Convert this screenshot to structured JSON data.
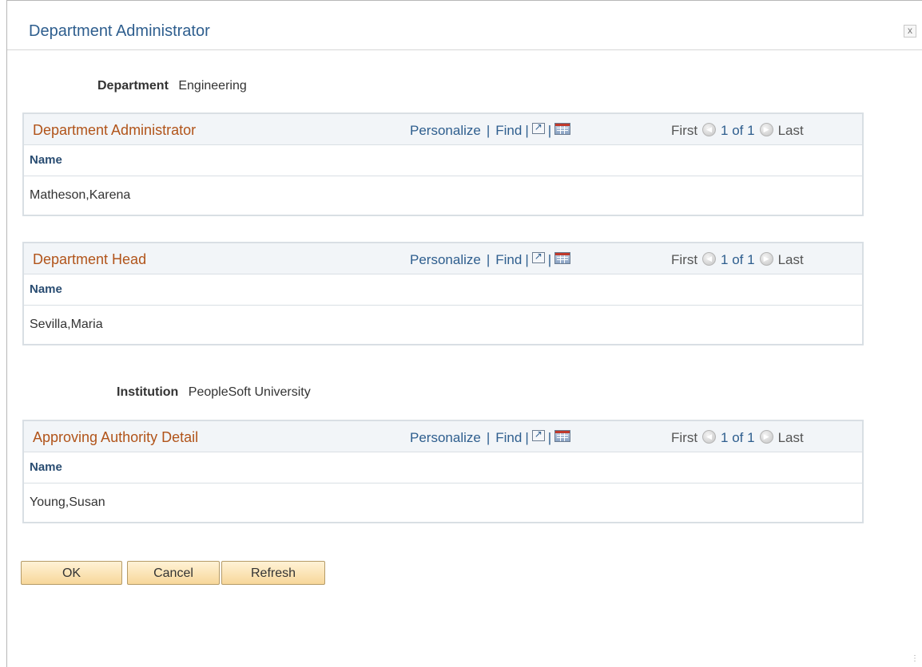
{
  "dialog": {
    "title": "Department Administrator",
    "close_label": "x"
  },
  "department": {
    "label": "Department",
    "value": "Engineering"
  },
  "institution": {
    "label": "Institution",
    "value": "PeopleSoft University"
  },
  "grid_nav": {
    "personalize": "Personalize",
    "separator": "|",
    "find": "Find",
    "first": "First",
    "last": "Last"
  },
  "grids": [
    {
      "title": "Department Administrator",
      "column": "Name",
      "row": "Matheson,Karena",
      "count": "1 of 1"
    },
    {
      "title": "Department Head",
      "column": "Name",
      "row": "Sevilla,Maria",
      "count": "1 of 1"
    },
    {
      "title": "Approving Authority Detail",
      "column": "Name",
      "row": "Young,Susan",
      "count": "1 of 1"
    }
  ],
  "buttons": {
    "ok": "OK",
    "cancel": "Cancel",
    "refresh": "Refresh"
  }
}
